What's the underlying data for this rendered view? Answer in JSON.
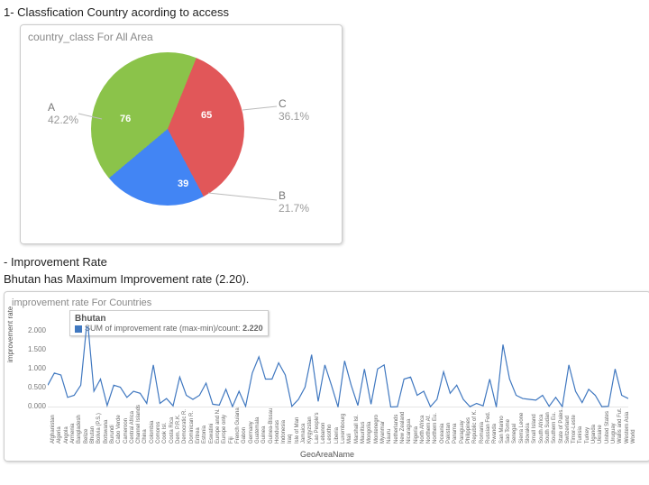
{
  "headings": {
    "h1": "1-   Classfication Country acording to  access",
    "h2_impr": "- Improvement Rate",
    "h3_bhutan": "Bhutan has Maximum Improvement rate (2.20)."
  },
  "chart_data": [
    {
      "type": "pie",
      "title": "country_class For All Area",
      "series": [
        {
          "name": "A",
          "value": 76,
          "pct": "42.2%",
          "color": "#8BC34A"
        },
        {
          "name": "C",
          "value": 65,
          "pct": "36.1%",
          "color": "#E15759"
        },
        {
          "name": "B",
          "value": 39,
          "pct": "21.7%",
          "color": "#4285F4"
        }
      ]
    },
    {
      "type": "line",
      "title": "improvement rate For Countries",
      "xlabel": "GeoAreaName",
      "ylabel": "improvement rate",
      "ylim": [
        0,
        2
      ],
      "yticks": [
        "0.000",
        "0.500",
        "1.000",
        "1.500",
        "2.000"
      ],
      "tooltip": {
        "country": "Bhutan",
        "metric": "SUM of improvement rate (max-min)/count",
        "value": "2.220"
      },
      "categories": [
        "Afghanistan",
        "Algeria",
        "Angola",
        "Armenia",
        "Bangladesh",
        "Belize",
        "Bhutan",
        "Bolivia (P.S.)",
        "Botswana",
        "Burundi",
        "Cabo Verde",
        "Cameroon",
        "Central Africa",
        "Channel Islands",
        "China",
        "Colombia",
        "Comoros",
        "Cook Isl.",
        "Costa Rica",
        "Dem. P.R.K.",
        "Democratic R.",
        "Dominican R.",
        "Eritrea",
        "Estonia",
        "Eswatini",
        "Europe and N.",
        "Europe only",
        "Fiji",
        "French Guiana",
        "Gabon",
        "Germany",
        "Guatemala",
        "Guinea",
        "Guinea-Bissau",
        "Honduras",
        "Indonesia",
        "Iraq",
        "Isle of Man",
        "Jamaica",
        "Kyrgyzstan",
        "Lao People's",
        "Lebanon",
        "Lesotho",
        "Liberia",
        "Luxembourg",
        "Mali",
        "Marshall Isl.",
        "Mauritius",
        "Mongolia",
        "Montenegro",
        "Myanmar",
        "Nauru",
        "Netherlands",
        "New Zealand",
        "Nicaragua",
        "Nigeria",
        "North Africa",
        "Northern Af.",
        "Northern Eu.",
        "Oceania",
        "Pakistan",
        "Panama",
        "Paraguay",
        "Philippines",
        "Republic of K.",
        "Romania",
        "Russian Fed.",
        "Rwanda",
        "San Marino",
        "Sao Tome",
        "Senegal",
        "Sierra Leone",
        "Slovakia",
        "Small Island",
        "South Africa",
        "South Sudan",
        "Southern Eu.",
        "State of Pales.",
        "Switzerland",
        "Timor-Leste",
        "Tunisia",
        "Turkey",
        "Uganda",
        "Ukraine",
        "United States",
        "Uruguay",
        "Wallis and Fut.",
        "Western Asia",
        "World"
      ],
      "values": [
        0.55,
        0.85,
        0.8,
        0.25,
        0.3,
        0.55,
        2.22,
        0.4,
        0.7,
        0.05,
        0.55,
        0.5,
        0.25,
        0.4,
        0.35,
        0.1,
        1.05,
        0.1,
        0.22,
        0.04,
        0.75,
        0.3,
        0.2,
        0.3,
        0.6,
        0.08,
        0.06,
        0.45,
        0.02,
        0.4,
        0.03,
        0.85,
        1.25,
        0.7,
        0.7,
        1.1,
        0.8,
        0.03,
        0.2,
        0.5,
        1.3,
        0.15,
        1.05,
        0.55,
        0.01,
        1.15,
        0.55,
        0.05,
        0.95,
        0.08,
        0.95,
        1.05,
        0.01,
        0.02,
        0.7,
        0.75,
        0.3,
        0.4,
        0.02,
        0.2,
        0.88,
        0.35,
        0.55,
        0.2,
        0.02,
        0.1,
        0.04,
        0.7,
        0.01,
        1.55,
        0.7,
        0.3,
        0.22,
        0.2,
        0.18,
        0.3,
        0.03,
        0.25,
        0.02,
        1.05,
        0.4,
        0.12,
        0.45,
        0.3,
        0.02,
        0.03,
        0.95,
        0.3,
        0.22
      ]
    }
  ]
}
